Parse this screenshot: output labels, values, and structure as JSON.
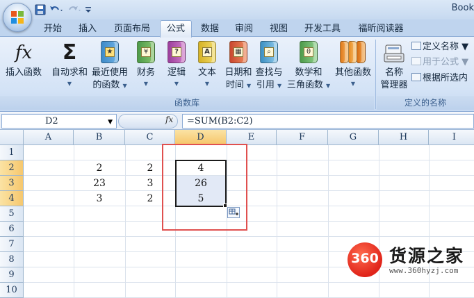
{
  "window": {
    "title": "Book"
  },
  "quick_access": {
    "items": [
      "save-icon",
      "undo-icon",
      "redo-icon",
      "customize-icon"
    ]
  },
  "tabs": [
    {
      "label": "开始",
      "active": false
    },
    {
      "label": "插入",
      "active": false
    },
    {
      "label": "页面布局",
      "active": false
    },
    {
      "label": "公式",
      "active": true
    },
    {
      "label": "数据",
      "active": false
    },
    {
      "label": "审阅",
      "active": false
    },
    {
      "label": "视图",
      "active": false
    },
    {
      "label": "开发工具",
      "active": false
    },
    {
      "label": "福昕阅读器",
      "active": false
    }
  ],
  "ribbon": {
    "function_library": {
      "group_label": "函数库",
      "insert_function": {
        "label": "插入函数",
        "icon": "fx"
      },
      "autosum": {
        "label": "自动求和",
        "icon": "Σ"
      },
      "recent": {
        "label1": "最近使用",
        "label2": "的函数"
      },
      "financial": {
        "label": "财务"
      },
      "logical": {
        "label": "逻辑"
      },
      "text": {
        "label": "文本"
      },
      "datetime": {
        "label1": "日期和",
        "label2": "时间"
      },
      "lookup": {
        "label1": "查找与",
        "label2": "引用"
      },
      "math": {
        "label1": "数学和",
        "label2": "三角函数"
      },
      "other": {
        "label": "其他函数"
      }
    },
    "defined_names": {
      "group_label": "定义的名称",
      "name_manager": {
        "label1": "名称",
        "label2": "管理器"
      },
      "define_name": "定义名称",
      "use_in_formula": "用于公式",
      "create_from_selection": "根据所选内"
    }
  },
  "formula_bar": {
    "name_box": "D2",
    "fx_label": "fx",
    "formula": "=SUM(B2:C2)"
  },
  "grid": {
    "columns": [
      "A",
      "B",
      "C",
      "D",
      "E",
      "F",
      "G",
      "H",
      "I"
    ],
    "rows": [
      "1",
      "2",
      "3",
      "4",
      "5",
      "6",
      "7",
      "8",
      "9",
      "10"
    ],
    "cells": {
      "B2": "2",
      "C2": "2",
      "D2": "4",
      "B3": "23",
      "C3": "3",
      "D3": "26",
      "B4": "3",
      "C4": "2",
      "D4": "5"
    },
    "selected_column": "D",
    "selected_rows": [
      "2",
      "3",
      "4"
    ],
    "selection_range": "D2:D4"
  },
  "watermark": {
    "badge": "360",
    "name": "货源之家",
    "url": "www.360hyzj.com"
  },
  "colors": {
    "highlight": "#e0504f",
    "ribbon_bg": "#d4e3f6",
    "header_selected": "#f6c76d"
  }
}
